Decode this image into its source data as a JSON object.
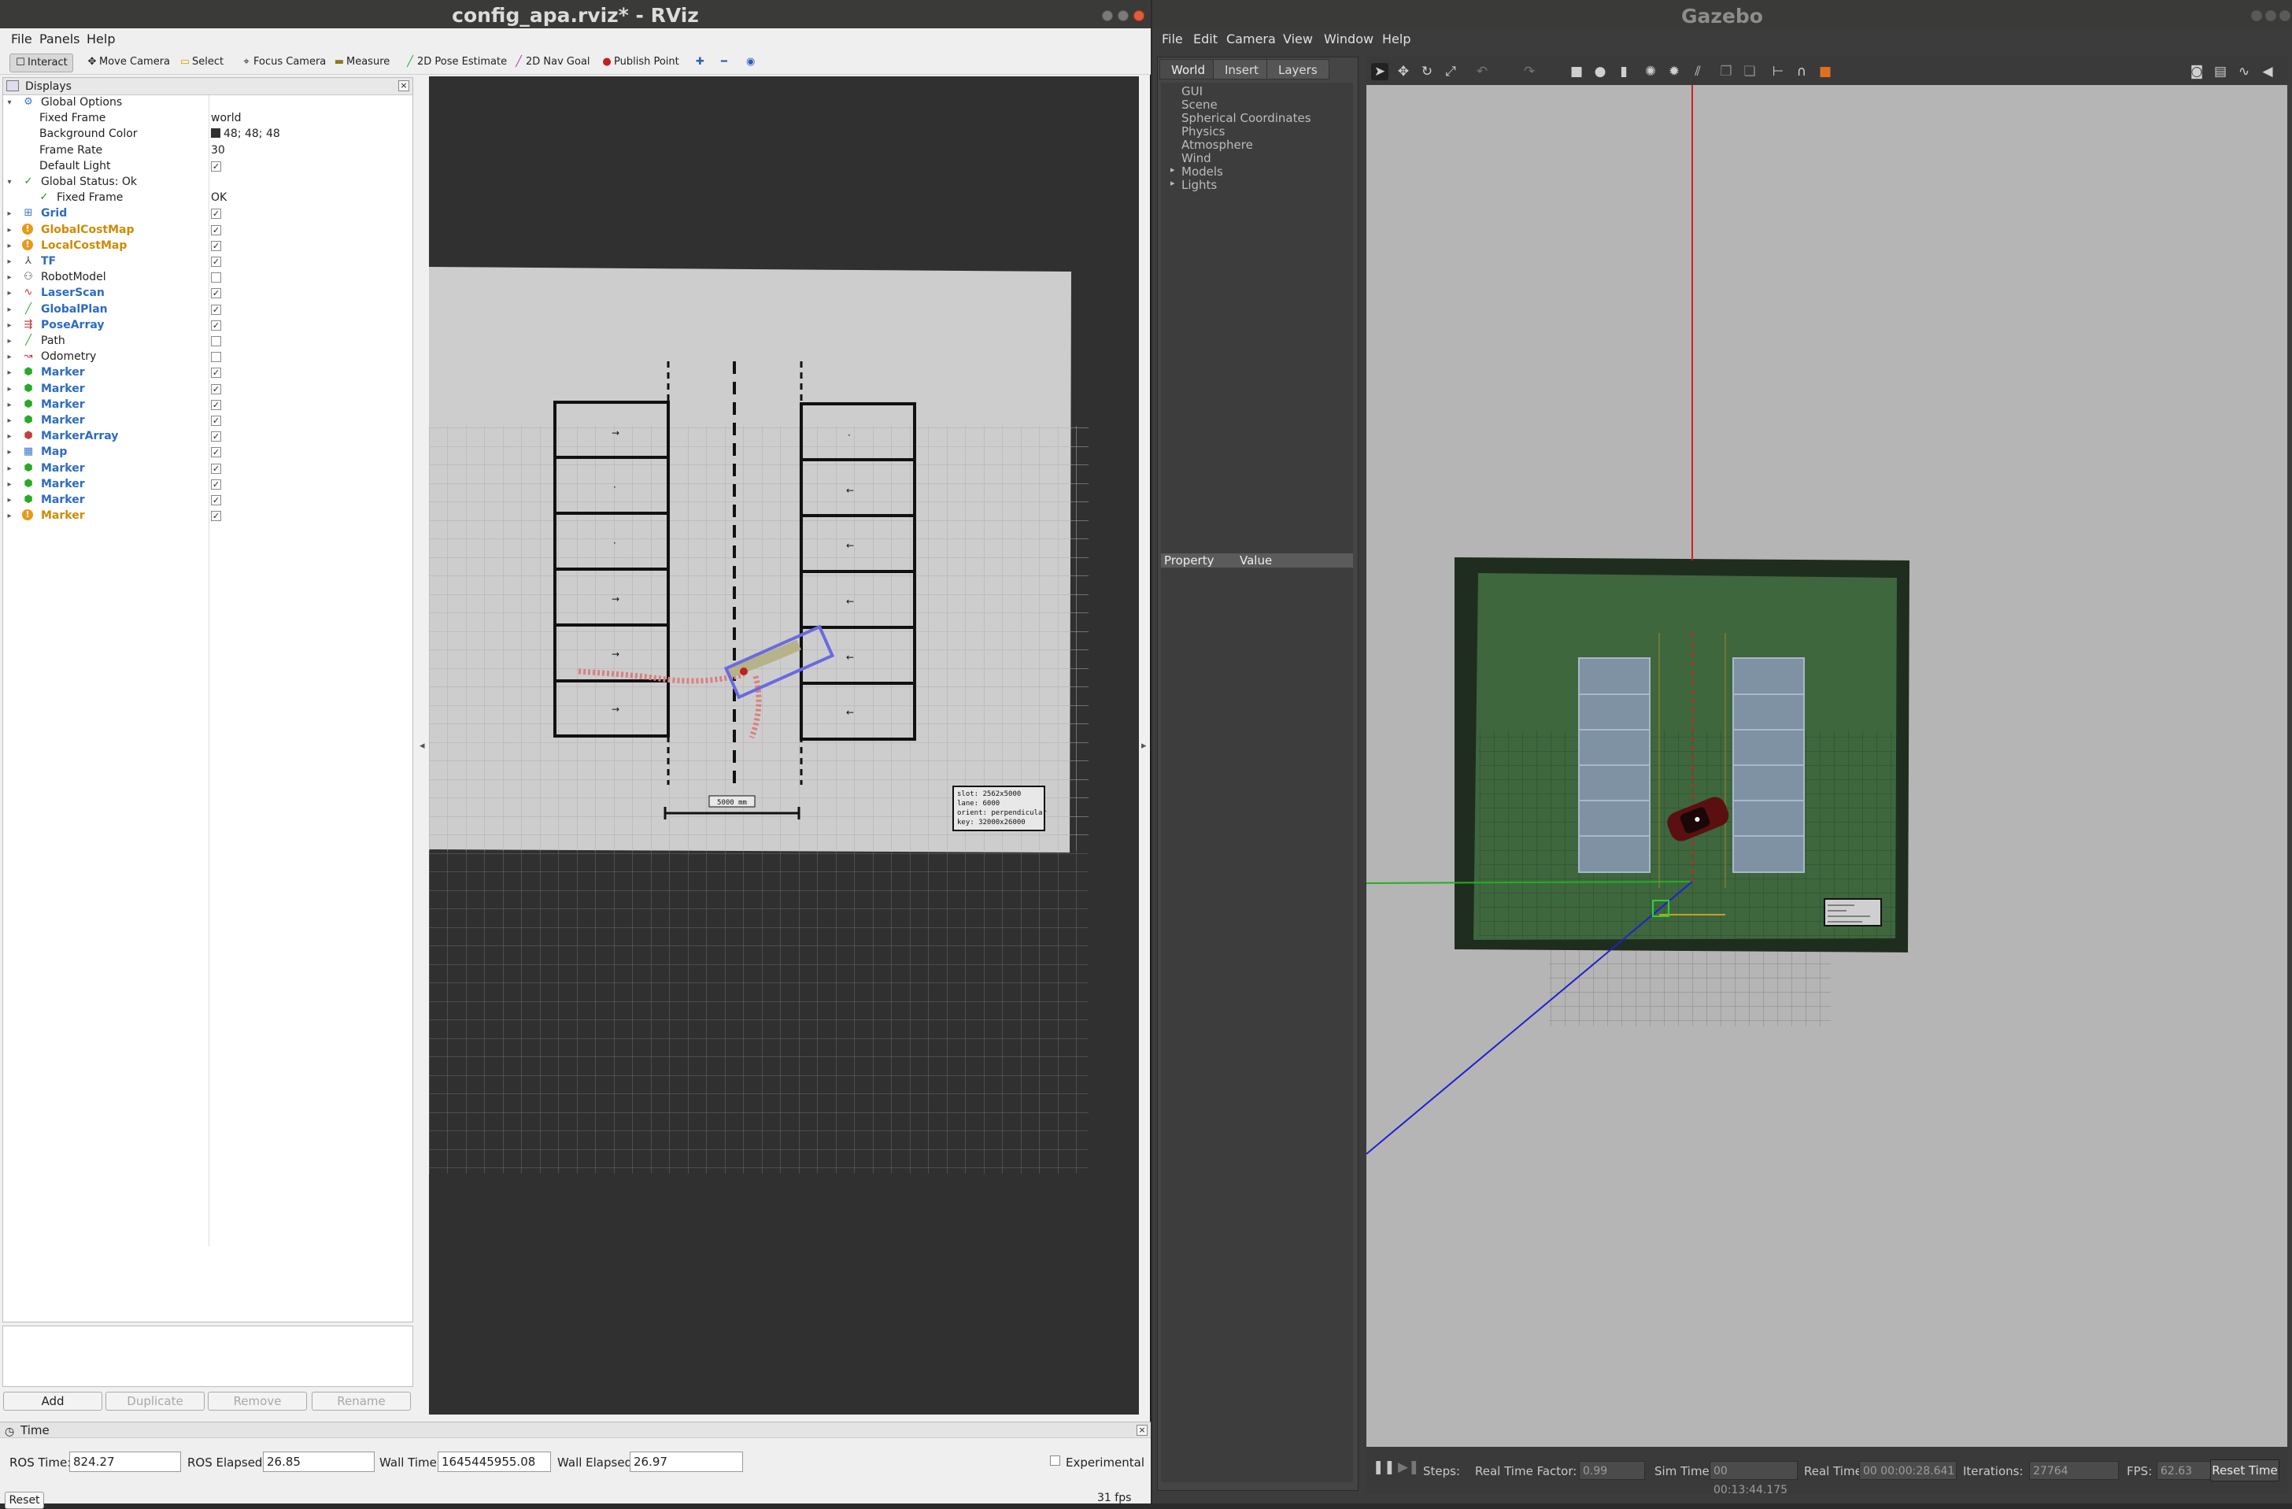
{
  "rviz": {
    "title": "config_apa.rviz* - RViz",
    "menu": [
      "File",
      "Panels",
      "Help"
    ],
    "toolbar": [
      "Interact",
      "Move Camera",
      "Select",
      "Focus Camera",
      "Measure",
      "2D Pose Estimate",
      "2D Nav Goal",
      "Publish Point"
    ],
    "displays_title": "Displays",
    "tree": [
      {
        "label": "Global Options",
        "level": 0,
        "expand": "open",
        "icon": "gear-icon"
      },
      {
        "label": "Fixed Frame",
        "level": 1,
        "value": "world"
      },
      {
        "label": "Background Color",
        "level": 1,
        "value": "48; 48; 48",
        "swatch": "#303030"
      },
      {
        "label": "Frame Rate",
        "level": 1,
        "value": "30"
      },
      {
        "label": "Default Light",
        "level": 1,
        "checked": true
      },
      {
        "label": "Global Status: Ok",
        "level": 0,
        "expand": "open",
        "icon": "check-icon"
      },
      {
        "label": "Fixed Frame",
        "level": 1,
        "value": "OK",
        "icon": "check-icon"
      },
      {
        "label": "Grid",
        "level": 0,
        "expand": "closed",
        "icon": "grid-icon",
        "checked": true,
        "style": "blue"
      },
      {
        "label": "GlobalCostMap",
        "level": 0,
        "expand": "closed",
        "icon": "warning-icon",
        "checked": true,
        "style": "orange"
      },
      {
        "label": "LocalCostMap",
        "level": 0,
        "expand": "closed",
        "icon": "warning-icon",
        "checked": true,
        "style": "orange"
      },
      {
        "label": "TF",
        "level": 0,
        "expand": "closed",
        "icon": "tf-icon",
        "checked": true,
        "style": "blue"
      },
      {
        "label": "RobotModel",
        "level": 0,
        "expand": "closed",
        "icon": "robot-icon",
        "checked": false
      },
      {
        "label": "LaserScan",
        "level": 0,
        "expand": "closed",
        "icon": "laser-icon",
        "checked": true,
        "style": "blue"
      },
      {
        "label": "GlobalPlan",
        "level": 0,
        "expand": "closed",
        "icon": "path-icon",
        "checked": true,
        "style": "blue"
      },
      {
        "label": "PoseArray",
        "level": 0,
        "expand": "closed",
        "icon": "pose-array-icon",
        "checked": true,
        "style": "blue"
      },
      {
        "label": "Path",
        "level": 0,
        "expand": "closed",
        "icon": "path-icon",
        "checked": false
      },
      {
        "label": "Odometry",
        "level": 0,
        "expand": "closed",
        "icon": "odometry-icon",
        "checked": false
      },
      {
        "label": "Marker",
        "level": 0,
        "expand": "closed",
        "icon": "marker-icon",
        "checked": true,
        "style": "blue"
      },
      {
        "label": "Marker",
        "level": 0,
        "expand": "closed",
        "icon": "marker-icon",
        "checked": true,
        "style": "blue"
      },
      {
        "label": "Marker",
        "level": 0,
        "expand": "closed",
        "icon": "marker-icon",
        "checked": true,
        "style": "blue"
      },
      {
        "label": "Marker",
        "level": 0,
        "expand": "closed",
        "icon": "marker-icon",
        "checked": true,
        "style": "blue"
      },
      {
        "label": "MarkerArray",
        "level": 0,
        "expand": "closed",
        "icon": "marker-array-icon",
        "checked": true,
        "style": "blue"
      },
      {
        "label": "Map",
        "level": 0,
        "expand": "closed",
        "icon": "map-icon",
        "checked": true,
        "style": "blue"
      },
      {
        "label": "Marker",
        "level": 0,
        "expand": "closed",
        "icon": "marker-icon",
        "checked": true,
        "style": "blue"
      },
      {
        "label": "Marker",
        "level": 0,
        "expand": "closed",
        "icon": "marker-icon",
        "checked": true,
        "style": "blue"
      },
      {
        "label": "Marker",
        "level": 0,
        "expand": "closed",
        "icon": "marker-icon",
        "checked": true,
        "style": "blue"
      },
      {
        "label": "Marker",
        "level": 0,
        "expand": "closed",
        "icon": "warning-icon",
        "checked": true,
        "style": "orange"
      }
    ],
    "buttons": {
      "add": "Add",
      "duplicate": "Duplicate",
      "remove": "Remove",
      "rename": "Rename"
    },
    "scene": {
      "scale_label": "5000 mm",
      "info_lines": [
        "slot: 2562x5000",
        "lane: 6000",
        "orient: perpendicular",
        "key: 32000x26000"
      ]
    },
    "time": {
      "title": "Time",
      "ros_time_label": "ROS Time:",
      "ros_time": "824.27",
      "ros_elapsed_label": "ROS Elapsed:",
      "ros_elapsed": "26.85",
      "wall_time_label": "Wall Time:",
      "wall_time": "1645445955.08",
      "wall_elapsed_label": "Wall Elapsed:",
      "wall_elapsed": "26.97",
      "experimental": "Experimental",
      "reset": "Reset",
      "fps": "31 fps"
    }
  },
  "gazebo": {
    "title": "Gazebo",
    "menu": [
      "File",
      "Edit",
      "Camera",
      "View",
      "Window",
      "Help"
    ],
    "tabs": [
      "World",
      "Insert",
      "Layers"
    ],
    "world_tree": [
      "GUI",
      "Scene",
      "Spherical Coordinates",
      "Physics",
      "Atmosphere",
      "Wind",
      "Models",
      "Lights"
    ],
    "property_header": "Property",
    "value_header": "Value",
    "bottom": {
      "steps_label": "Steps:",
      "rtf_label": "Real Time Factor:",
      "rtf": "0.99",
      "sim_time_label": "Sim Time:",
      "sim_time": "00 00:13:44.175",
      "real_time_label": "Real Time:",
      "real_time": "00 00:00:28.641",
      "iterations_label": "Iterations:",
      "iterations": "27764",
      "fps_label": "FPS:",
      "fps": "62.63",
      "reset_time": "Reset Time"
    }
  }
}
